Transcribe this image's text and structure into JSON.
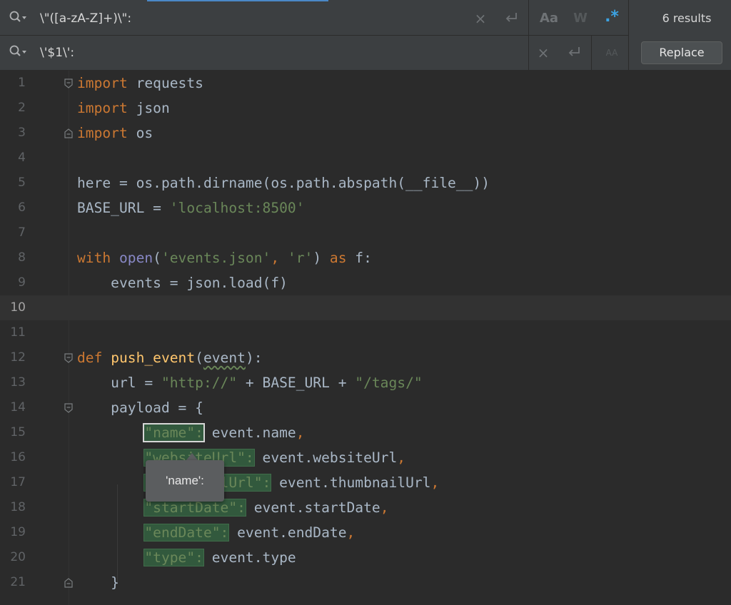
{
  "find": {
    "search_value": "\\\"([a-zA-Z]+)\\\":",
    "replace_value": "\\'$1\\':",
    "results_label": "6 results",
    "replace_button": "Replace",
    "match_case_label": "Aa",
    "words_label": "W",
    "regex_label": ".*",
    "preserve_case_label": "AA",
    "icons": {
      "search": "search-history-icon",
      "replace": "replace-history-icon",
      "clear": "clear-icon",
      "newline": "newline-icon"
    },
    "accent_color": "#3ca3e3"
  },
  "editor": {
    "current_line": 10,
    "line_numbers": [
      "1",
      "2",
      "3",
      "4",
      "5",
      "6",
      "7",
      "8",
      "9",
      "10",
      "11",
      "12",
      "13",
      "14",
      "15",
      "16",
      "17",
      "18",
      "19",
      "20",
      "21"
    ],
    "lines": {
      "l1": {
        "kw": "import",
        "rest": " requests"
      },
      "l2": {
        "kw": "import",
        "rest": " json"
      },
      "l3": {
        "kw": "import",
        "rest": " os"
      },
      "l5": {
        "text": "here = os.path.dirname(os.path.abspath(__file__))"
      },
      "l6": {
        "a": "BASE_URL = ",
        "str": "'localhost:8500'"
      },
      "l8": {
        "kw1": "with",
        "bi": "open",
        "p1": "(",
        "s1": "'events.json'",
        "p2": ", ",
        "s2": "'r'",
        "p3": ") ",
        "kw2": "as",
        "p4": " f:"
      },
      "l9": {
        "text": "    events = json.load(f)"
      },
      "l12": {
        "kw": "def",
        "fn": "push_event",
        "p1": "(",
        "param": "event",
        "p2": "):"
      },
      "l13": {
        "a": "    url = ",
        "s1": "\"http://\"",
        "b": " + BASE_URL + ",
        "s2": "\"/tags/\""
      },
      "l14": {
        "text": "    payload = {"
      },
      "l15": {
        "key": "\"name\":",
        "val": " event.name",
        "comma": ","
      },
      "l16": {
        "key": "\"websiteUrl\":",
        "val": " event.websiteUrl",
        "comma": ","
      },
      "l17": {
        "key": "\"thumbnailUrl\":",
        "val": " event.thumbnailUrl",
        "comma": ","
      },
      "l18": {
        "key": "\"startDate\":",
        "val": " event.startDate",
        "comma": ","
      },
      "l19": {
        "key": "\"endDate\":",
        "val": " event.endDate",
        "comma": ","
      },
      "l20": {
        "key": "\"type\":",
        "val": " event.type"
      },
      "l21": {
        "text": "    }"
      }
    }
  },
  "tooltip": {
    "text": "'name':"
  }
}
